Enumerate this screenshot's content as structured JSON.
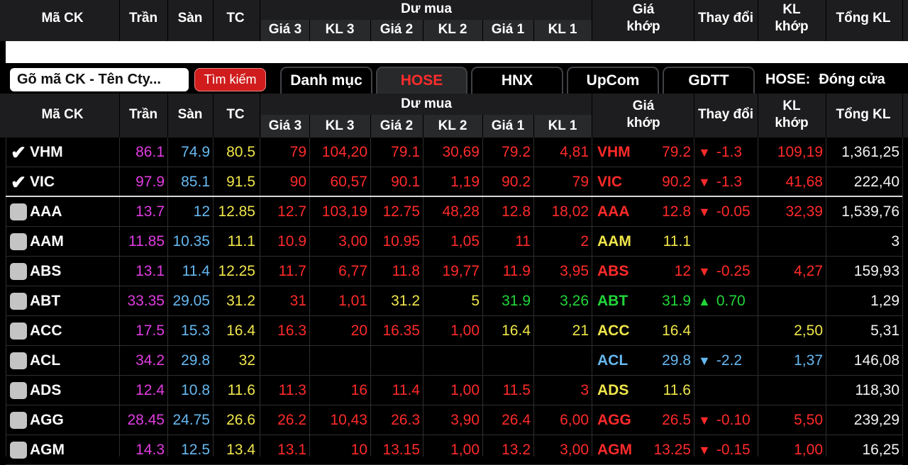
{
  "columns": {
    "symbol": "Mã CK",
    "ceil": "Trần",
    "floor": "Sàn",
    "ref": "TC",
    "bid_group": "Dư mua",
    "bid": [
      "Giá 3",
      "KL 3",
      "Giá 2",
      "KL 2",
      "Giá 1",
      "KL 1"
    ],
    "match_price_l1": "Giá",
    "match_price_l2": "khớp",
    "change": "Thay đổi",
    "match_vol_l1": "KL",
    "match_vol_l2": "khớp",
    "total_vol": "Tổng KL"
  },
  "search": {
    "placeholder": "Gõ mã CK - Tên Cty...",
    "button": "Tìm kiếm"
  },
  "tabs": [
    {
      "label": "Danh mục"
    },
    {
      "label": "HOSE",
      "active": true
    },
    {
      "label": "HNX"
    },
    {
      "label": "UpCom"
    },
    {
      "label": "GDTT"
    }
  ],
  "status": {
    "exchange": "HOSE:",
    "state": "Đóng cửa"
  },
  "colors": {
    "ceil": "#e03ce0",
    "floor": "#67b8f0",
    "ref": "#f0e64a",
    "down": "#ff2a2a",
    "up": "#22d63a",
    "unchanged": "#f0e64a",
    "floor_hit": "#67b8f0"
  },
  "rows": [
    {
      "sym": "VHM",
      "checked": true,
      "ceil": "86.1",
      "floor": "74.9",
      "ref": "80.5",
      "b3": "79",
      "v3": "104,20",
      "b2": "79.1",
      "v2": "30,69",
      "b1": "79.2",
      "v1": "4,81",
      "price": "79.2",
      "arrow": "▼",
      "chg": "-1.3",
      "mvol": "109,19",
      "tvol": "1,361,25",
      "col": {
        "b3": "red",
        "v3": "red",
        "b2": "red",
        "v2": "red",
        "b1": "red",
        "v1": "red",
        "price": "red",
        "chg": "red",
        "mvol": "red"
      }
    },
    {
      "sym": "VIC",
      "checked": true,
      "ceil": "97.9",
      "floor": "85.1",
      "ref": "91.5",
      "b3": "90",
      "v3": "60,57",
      "b2": "90.1",
      "v2": "1,19",
      "b1": "90.2",
      "v1": "79",
      "price": "90.2",
      "arrow": "▼",
      "chg": "-1.3",
      "mvol": "41,68",
      "tvol": "222,40",
      "col": {
        "b3": "red",
        "v3": "red",
        "b2": "red",
        "v2": "red",
        "b1": "red",
        "v1": "red",
        "price": "red",
        "chg": "red",
        "mvol": "red"
      }
    },
    {
      "sym": "AAA",
      "checked": false,
      "ceil": "13.7",
      "floor": "12",
      "ref": "12.85",
      "b3": "12.7",
      "v3": "103,19",
      "b2": "12.75",
      "v2": "48,28",
      "b1": "12.8",
      "v1": "18,02",
      "price": "12.8",
      "arrow": "▼",
      "chg": "-0.05",
      "mvol": "32,39",
      "tvol": "1,539,76",
      "col": {
        "b3": "red",
        "v3": "red",
        "b2": "red",
        "v2": "red",
        "b1": "red",
        "v1": "red",
        "price": "red",
        "chg": "red",
        "mvol": "red"
      }
    },
    {
      "sym": "AAM",
      "checked": false,
      "ceil": "11.85",
      "floor": "10.35",
      "ref": "11.1",
      "b3": "10.9",
      "v3": "3,00",
      "b2": "10.95",
      "v2": "1,05",
      "b1": "11",
      "v1": "2",
      "price": "11.1",
      "arrow": "",
      "chg": "",
      "mvol": "",
      "tvol": "3",
      "col": {
        "b3": "red",
        "v3": "red",
        "b2": "red",
        "v2": "red",
        "b1": "red",
        "v1": "red",
        "price": "yel",
        "chg": "yel",
        "mvol": "yel"
      }
    },
    {
      "sym": "ABS",
      "checked": false,
      "ceil": "13.1",
      "floor": "11.4",
      "ref": "12.25",
      "b3": "11.7",
      "v3": "6,77",
      "b2": "11.8",
      "v2": "19,77",
      "b1": "11.9",
      "v1": "3,95",
      "price": "12",
      "arrow": "▼",
      "chg": "-0.25",
      "mvol": "4,27",
      "tvol": "159,93",
      "col": {
        "b3": "red",
        "v3": "red",
        "b2": "red",
        "v2": "red",
        "b1": "red",
        "v1": "red",
        "price": "red",
        "chg": "red",
        "mvol": "red"
      }
    },
    {
      "sym": "ABT",
      "checked": false,
      "ceil": "33.35",
      "floor": "29.05",
      "ref": "31.2",
      "b3": "31",
      "v3": "1,01",
      "b2": "31.2",
      "v2": "5",
      "b1": "31.9",
      "v1": "3,26",
      "price": "31.9",
      "arrow": "▲",
      "chg": "0.70",
      "mvol": "",
      "tvol": "1,29",
      "col": {
        "b3": "red",
        "v3": "red",
        "b2": "yel",
        "v2": "yel",
        "b1": "green",
        "v1": "green",
        "price": "green",
        "chg": "green",
        "mvol": "green"
      }
    },
    {
      "sym": "ACC",
      "checked": false,
      "ceil": "17.5",
      "floor": "15.3",
      "ref": "16.4",
      "b3": "16.3",
      "v3": "20",
      "b2": "16.35",
      "v2": "1,00",
      "b1": "16.4",
      "v1": "21",
      "price": "16.4",
      "arrow": "",
      "chg": "",
      "mvol": "2,50",
      "tvol": "5,31",
      "col": {
        "b3": "red",
        "v3": "red",
        "b2": "red",
        "v2": "red",
        "b1": "yel",
        "v1": "yel",
        "price": "yel",
        "chg": "yel",
        "mvol": "yel"
      }
    },
    {
      "sym": "ACL",
      "checked": false,
      "ceil": "34.2",
      "floor": "29.8",
      "ref": "32",
      "b3": "",
      "v3": "",
      "b2": "",
      "v2": "",
      "b1": "",
      "v1": "",
      "price": "29.8",
      "arrow": "▼",
      "chg": "-2.2",
      "mvol": "1,37",
      "tvol": "146,08",
      "col": {
        "b3": "red",
        "v3": "red",
        "b2": "red",
        "v2": "red",
        "b1": "red",
        "v1": "red",
        "price": "blue",
        "chg": "blue",
        "mvol": "blue"
      }
    },
    {
      "sym": "ADS",
      "checked": false,
      "ceil": "12.4",
      "floor": "10.8",
      "ref": "11.6",
      "b3": "11.3",
      "v3": "16",
      "b2": "11.4",
      "v2": "1,00",
      "b1": "11.5",
      "v1": "3",
      "price": "11.6",
      "arrow": "",
      "chg": "",
      "mvol": "",
      "tvol": "118,30",
      "col": {
        "b3": "red",
        "v3": "red",
        "b2": "red",
        "v2": "red",
        "b1": "red",
        "v1": "red",
        "price": "yel",
        "chg": "yel",
        "mvol": "yel"
      }
    },
    {
      "sym": "AGG",
      "checked": false,
      "ceil": "28.45",
      "floor": "24.75",
      "ref": "26.6",
      "b3": "26.2",
      "v3": "10,43",
      "b2": "26.3",
      "v2": "3,90",
      "b1": "26.4",
      "v1": "6,00",
      "price": "26.5",
      "arrow": "▼",
      "chg": "-0.10",
      "mvol": "5,50",
      "tvol": "239,29",
      "col": {
        "b3": "red",
        "v3": "red",
        "b2": "red",
        "v2": "red",
        "b1": "red",
        "v1": "red",
        "price": "red",
        "chg": "red",
        "mvol": "red"
      }
    },
    {
      "sym": "AGM",
      "checked": false,
      "ceil": "14.3",
      "floor": "12.5",
      "ref": "13.4",
      "b3": "13.1",
      "v3": "10",
      "b2": "13.15",
      "v2": "1,00",
      "b1": "13.2",
      "v1": "3,00",
      "price": "13.25",
      "arrow": "▼",
      "chg": "-0.15",
      "mvol": "1,00",
      "tvol": "16,25",
      "col": {
        "b3": "red",
        "v3": "red",
        "b2": "red",
        "v2": "red",
        "b1": "red",
        "v1": "red",
        "price": "red",
        "chg": "red",
        "mvol": "red"
      }
    }
  ]
}
